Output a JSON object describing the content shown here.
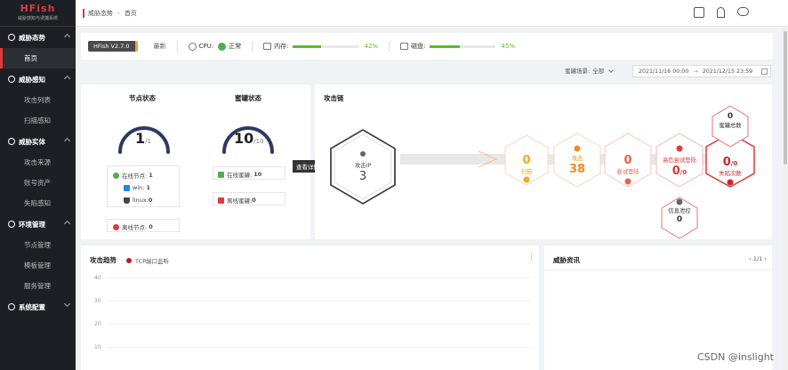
{
  "brand": {
    "name": "HFish",
    "tagline": "威胁感知与诱捕系统"
  },
  "breadcrumb": [
    "威胁态势",
    "首页"
  ],
  "sidebar": {
    "groups": [
      {
        "label": "威胁态势",
        "items": [
          "首页"
        ]
      },
      {
        "label": "威胁感知",
        "items": [
          "攻击列表",
          "扫描感知"
        ]
      },
      {
        "label": "威胁实体",
        "items": [
          "攻击来源",
          "账号资产",
          "失陷感知"
        ]
      },
      {
        "label": "环境管理",
        "items": [
          "节点管理",
          "模板管理",
          "服务管理"
        ]
      },
      {
        "label": "系统配置",
        "items": []
      }
    ],
    "active": "首页"
  },
  "status": {
    "version": "HFish V2.7.0",
    "newest": "最新",
    "cpu_label": "CPU:",
    "cpu_status": "正常",
    "mem_label": "内存:",
    "mem_pct": "42%",
    "mem_value": 42,
    "disk_label": "磁盘:",
    "disk_pct": "45%",
    "disk_value": 45
  },
  "filter": {
    "label": "蜜罐场景:",
    "value": "全部",
    "date_start": "2021/11/16 00:00",
    "date_end": "2021/12/15 23:59"
  },
  "node_status": {
    "title": "节点状态",
    "value": "1",
    "total": "/1",
    "online_label": "在线节点:",
    "online": "1",
    "win_label": "win:",
    "win": "1",
    "linux_label": "linux:",
    "linux": "0",
    "offline_label": "离线节点:",
    "offline": "0"
  },
  "honeypot_status": {
    "title": "蜜罐状态",
    "value": "10",
    "total": "/10",
    "online_label": "在线蜜罐:",
    "online": "10",
    "offline_label": "离线蜜罐:",
    "offline": "0"
  },
  "view_detail": "查看详情",
  "attack_chain": {
    "title": "攻击链",
    "source": {
      "label": "攻击IP",
      "value": "3"
    },
    "stages": [
      {
        "label": "扫描",
        "value": "0",
        "color": "#f5a623"
      },
      {
        "label": "攻击",
        "value": "38",
        "color": "#f08a24"
      },
      {
        "label": "尝试登陆",
        "value": "0",
        "color": "#e8604c"
      },
      {
        "label": "高危尝试登陆",
        "value": "0",
        "total": "/0",
        "color": "#e0393e"
      },
      {
        "label": "失陷次数",
        "value": "0",
        "total": "/0",
        "color": "#c62828"
      }
    ],
    "honeypot_total": {
      "label": "蜜罐总数",
      "value": "0"
    },
    "info_leak": {
      "label": "信息泄控",
      "value": "0"
    }
  },
  "trend": {
    "title": "攻击趋势",
    "legend": "TCP端口监听",
    "yticks": [
      "40",
      "30",
      "20",
      "10"
    ]
  },
  "intel": {
    "title": "威胁资讯",
    "page": "1/1"
  },
  "watermark": "CSDN @inslight",
  "colors": {
    "accent": "#e0393e",
    "sidebar": "#1c1f24",
    "gauge": "#2f3a62",
    "ok": "#52c41a"
  }
}
